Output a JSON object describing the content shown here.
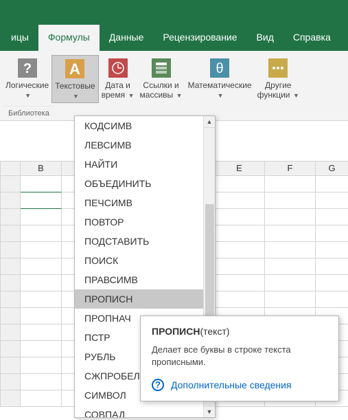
{
  "tabs": {
    "t0": "ицы",
    "t1": "Формулы",
    "t2": "Данные",
    "t3": "Рецензирование",
    "t4": "Вид",
    "t5": "Справка"
  },
  "ribbon": {
    "logical": "Логические",
    "text": "Текстовые",
    "datetime1": "Дата и",
    "datetime2": "время",
    "lookup1": "Ссылки и",
    "lookup2": "массивы",
    "math": "Математические",
    "more1": "Другие",
    "more2": "функции",
    "group": "Библиотека"
  },
  "cols": {
    "b": "B",
    "e": "E",
    "f": "F",
    "g": "G"
  },
  "dropdown": {
    "items": [
      "КОДСИМВ",
      "ЛЕВСИМВ",
      "НАЙТИ",
      "ОБЪЕДИНИТЬ",
      "ПЕЧСИМВ",
      "ПОВТОР",
      "ПОДСТАВИТЬ",
      "ПОИСК",
      "ПРАВСИМВ",
      "ПРОПИСН",
      "ПРОПНАЧ",
      "ПСТР",
      "РУБЛЬ",
      "СЖПРОБЕЛЫ",
      "СИМВОЛ",
      "СОВПАД"
    ],
    "selectedIndex": 9
  },
  "tooltip": {
    "fn": "ПРОПИСН",
    "arg": "(текст)",
    "desc": "Делает все буквы в строке текста прописными.",
    "link": "Дополнительные сведения"
  }
}
